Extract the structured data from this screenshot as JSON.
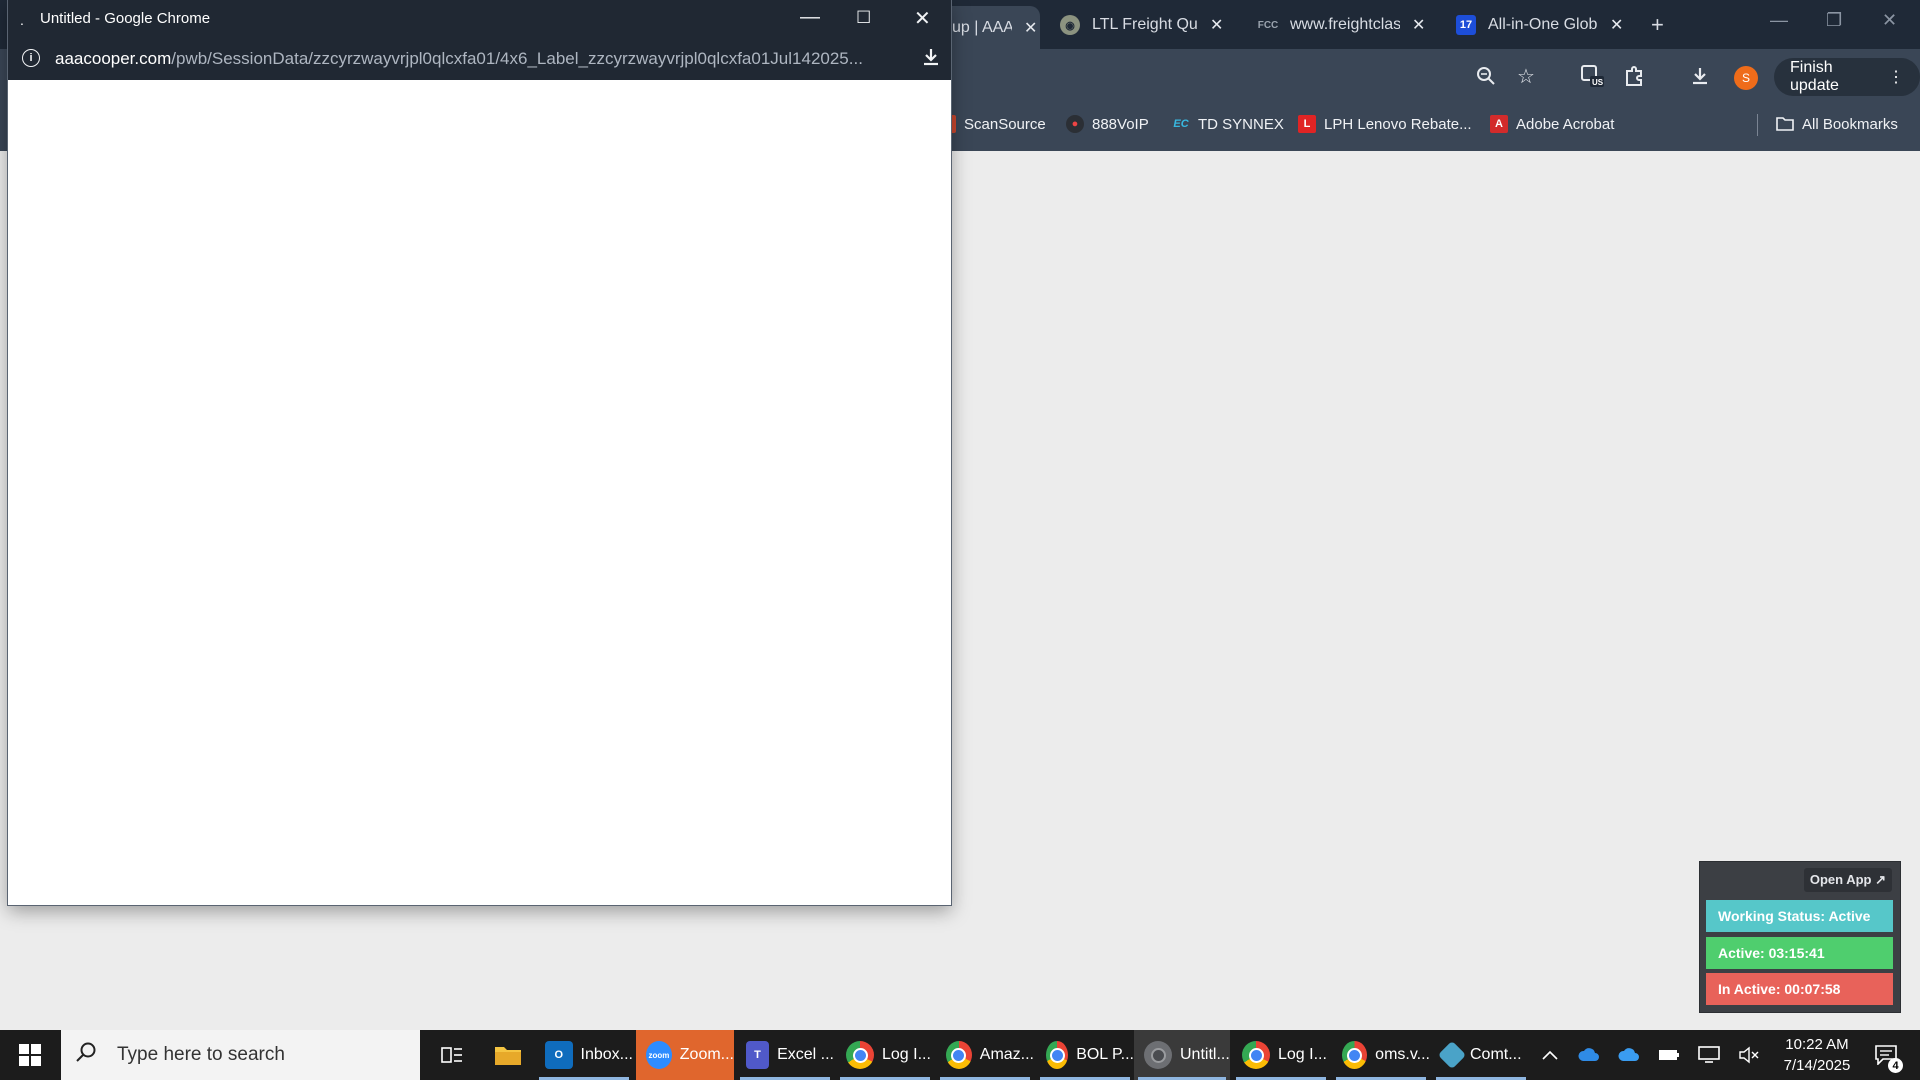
{
  "background_browser": {
    "tabs": [
      {
        "label": "up | AAA",
        "favicon": "none",
        "active": true
      },
      {
        "label": "LTL Freight Quot",
        "favicon": "globe-icon",
        "active": false
      },
      {
        "label": "www.freightclass",
        "favicon": "fcc-icon",
        "active": false
      },
      {
        "label": "All-in-One Globa",
        "favicon": "17track-icon",
        "active": false
      }
    ],
    "favicon_text": {
      "fcc": "FCC",
      "track": "17"
    },
    "finish_update_label": "Finish update",
    "avatar_initial": "S",
    "bookmarks": [
      {
        "label": "ScanSource",
        "icon": "scansource-icon"
      },
      {
        "label": "888VoIP",
        "icon": "888voip-icon"
      },
      {
        "label": "TD SYNNEX",
        "icon": "tdsynnex-icon"
      },
      {
        "label": "LPH Lenovo Rebate...",
        "icon": "lenovo-icon"
      },
      {
        "label": "Adobe Acrobat",
        "icon": "acrobat-icon"
      },
      {
        "label": "All Bookmarks",
        "icon": "folder-icon"
      }
    ],
    "bookmark_icon_text": {
      "td": "EC",
      "lenovo": "L",
      "acrobat": "A"
    }
  },
  "popup_window": {
    "title": "Untitled - Google Chrome",
    "url_host": "aaacooper.com",
    "url_path": "/pwb/SessionData/zzcyrzwayvrjpl0qlcxfa01/4x6_Label_zzcyrzwayvrjpl0qlcxfa01Jul142025..."
  },
  "tracker": {
    "open_app": "Open App ↗",
    "working_status": "Working Status: Active",
    "active": "Active: 03:15:41",
    "inactive": "In Active: 00:07:58"
  },
  "taskbar": {
    "search_placeholder": "Type here to search",
    "apps": [
      {
        "label": "Inbox...",
        "icon": "outlook-icon"
      },
      {
        "label": "Zoom...",
        "icon": "zoom-icon",
        "highlighted": true
      },
      {
        "label": "Excel ...",
        "icon": "teams-icon"
      },
      {
        "label": "Log I...",
        "icon": "chrome-icon"
      },
      {
        "label": "Amaz...",
        "icon": "chrome-icon"
      },
      {
        "label": "BOL P...",
        "icon": "chrome-icon"
      },
      {
        "label": "Untitl...",
        "icon": "chrome-gray-icon",
        "selected": true
      },
      {
        "label": "Log I...",
        "icon": "chrome-profile-icon"
      },
      {
        "label": "oms.v...",
        "icon": "chrome-profile-icon"
      },
      {
        "label": "Comt...",
        "icon": "comtrade-icon"
      }
    ],
    "app_icon_text": {
      "outlook": "O",
      "zoom": "zoom",
      "teams": "T"
    },
    "time": "10:22 AM",
    "date": "7/14/2025",
    "notification_count": "4"
  },
  "colors": {
    "chrome_frame": "#202833",
    "tab_strip": "#1f2937",
    "toolbar": "#3a4656",
    "tracker_status": "#56c7c9",
    "tracker_active": "#4fce6e",
    "tracker_inactive": "#e8625a",
    "zoom_highlight": "#e0662d"
  }
}
